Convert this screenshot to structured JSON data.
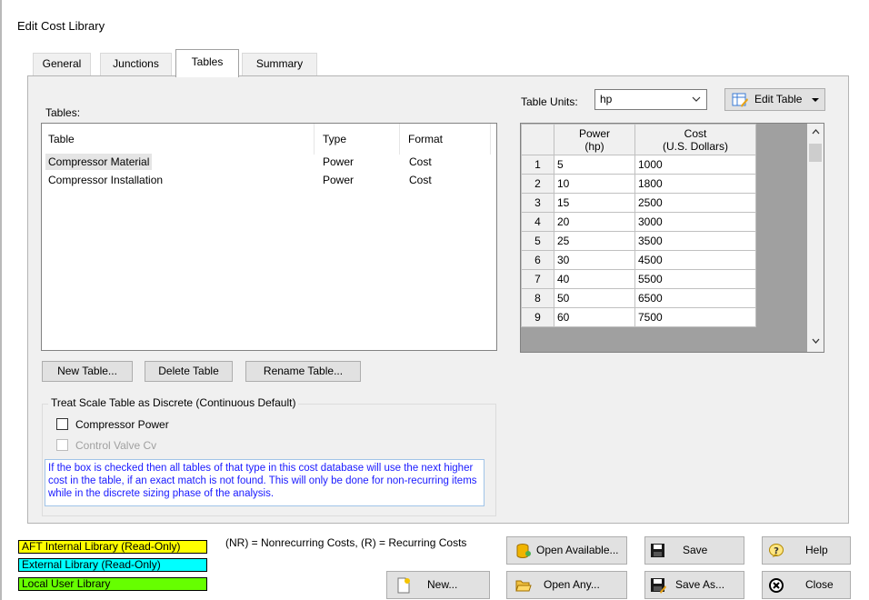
{
  "window": {
    "title": "Edit Cost Library"
  },
  "tabs": [
    {
      "label": "General"
    },
    {
      "label": "Junctions"
    },
    {
      "label": "Tables"
    },
    {
      "label": "Summary"
    }
  ],
  "tables_panel": {
    "label": "Tables:",
    "columns": [
      "Table",
      "Type",
      "Format"
    ],
    "rows": [
      {
        "table": "Compressor Material",
        "type": "Power",
        "format": "Cost"
      },
      {
        "table": "Compressor Installation",
        "type": "Power",
        "format": "Cost"
      }
    ],
    "buttons": {
      "new": "New Table...",
      "delete": "Delete Table",
      "rename": "Rename Table..."
    }
  },
  "discrete": {
    "title": "Treat Scale Table as Discrete (Continuous Default)",
    "options": [
      {
        "label": "Compressor Power",
        "checked": false,
        "enabled": true
      },
      {
        "label": "Control Valve Cv",
        "checked": false,
        "enabled": false
      }
    ],
    "info": "If the box is checked then all tables of that type in this cost database will use the next higher cost in the table, if an exact match is not found. This will only be done for non-recurring items while in the discrete sizing phase of the analysis."
  },
  "table_units": {
    "label": "Table Units:",
    "value": "hp"
  },
  "edit_table_button": "Edit Table",
  "data_table": {
    "headers": [
      {
        "line1": "Power",
        "line2": "(hp)"
      },
      {
        "line1": "Cost",
        "line2": "(U.S. Dollars)"
      }
    ],
    "rows": [
      {
        "n": "1",
        "power": "5",
        "cost": "1000"
      },
      {
        "n": "2",
        "power": "10",
        "cost": "1800"
      },
      {
        "n": "3",
        "power": "15",
        "cost": "2500"
      },
      {
        "n": "4",
        "power": "20",
        "cost": "3000"
      },
      {
        "n": "5",
        "power": "25",
        "cost": "3500"
      },
      {
        "n": "6",
        "power": "30",
        "cost": "4500"
      },
      {
        "n": "7",
        "power": "40",
        "cost": "5500"
      },
      {
        "n": "8",
        "power": "50",
        "cost": "6500"
      },
      {
        "n": "9",
        "power": "60",
        "cost": "7500"
      }
    ]
  },
  "libraries": [
    {
      "label": "AFT Internal Library (Read-Only)",
      "color": "#ffff00"
    },
    {
      "label": "External Library (Read-Only)",
      "color": "#00ffff"
    },
    {
      "label": "Local User Library",
      "color": "#66ff00"
    }
  ],
  "legend_note": "(NR) = Nonrecurring Costs, (R) = Recurring Costs",
  "bottom_buttons": {
    "new": "New...",
    "open_available": "Open Available...",
    "open_any": "Open Any...",
    "save": "Save",
    "save_as": "Save As...",
    "help": "Help",
    "close": "Close"
  }
}
